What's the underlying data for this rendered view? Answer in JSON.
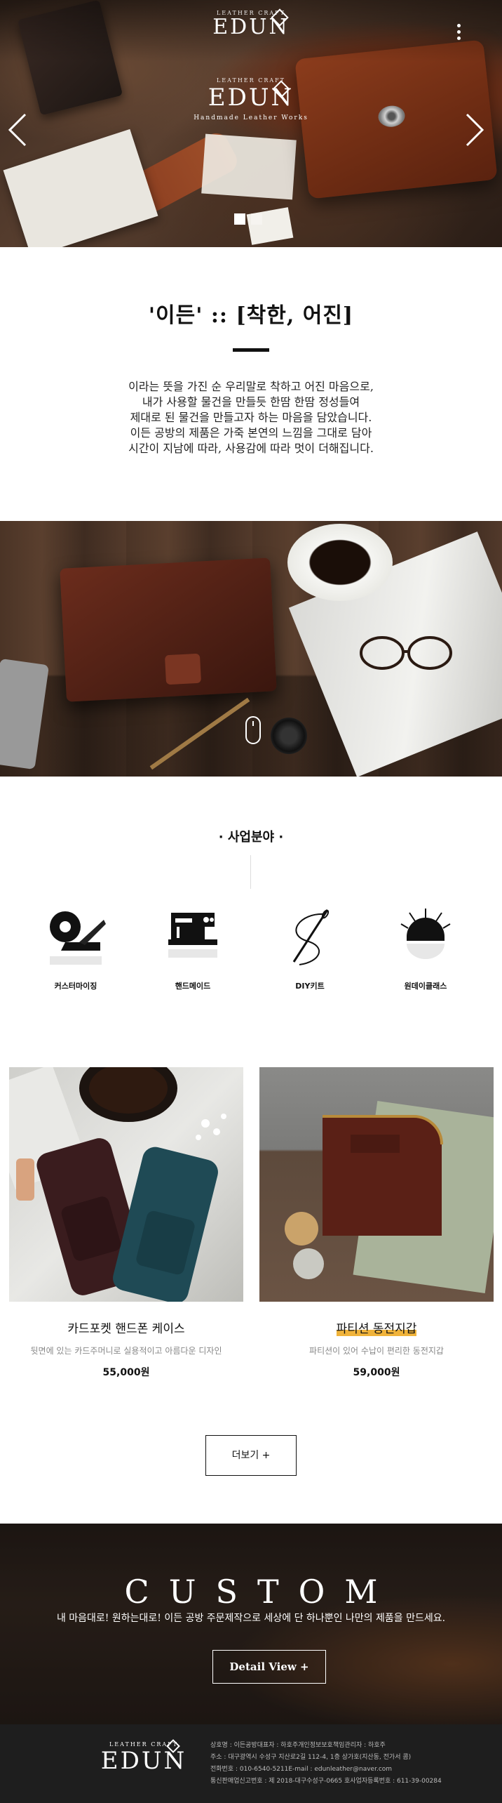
{
  "header": {
    "brand_small": "LEATHER CRAFT",
    "brand_name": "EDUN",
    "menu_icon": "more-vertical-icon"
  },
  "hero": {
    "brand_small": "LEATHER CRAFT",
    "brand_name": "EDUN",
    "tagline": "Handmade Leather Works",
    "slides_total": 2,
    "slide_active": 1
  },
  "intro": {
    "title": "'이든' :: [착한, 어진]",
    "lines": [
      "이라는 뜻을 가진 순 우리말로 착하고 어진 마음으로,",
      "내가 사용할 물건을 만들듯 한땀 한땀 정성들여",
      "제대로 된 물건을 만들고자 하는 마음을 담았습니다.",
      "이든 공방의 제품은 가죽 본연의 느낌을 그대로 담아",
      "시간이 지남에 따라, 사용감에 따라 멋이 더해집니다."
    ]
  },
  "business": {
    "title": "· 사업분야 ·",
    "items": [
      {
        "label": "커스터마이징",
        "icon": "measuring-tape-icon"
      },
      {
        "label": "핸드메이드",
        "icon": "sewing-machine-icon"
      },
      {
        "label": "DIY키트",
        "icon": "needle-thread-icon"
      },
      {
        "label": "원데이클래스",
        "icon": "pincushion-icon"
      }
    ]
  },
  "products": [
    {
      "name": "카드포켓 핸드폰 케이스",
      "desc": "뒷면에 있는 카드주머니로 실용적이고 아름다운 디자인",
      "price": "55,000원"
    },
    {
      "name": "파티션 동전지갑",
      "desc": "파티션이 있어 수납이 편리한 동전지갑",
      "price": "59,000원"
    }
  ],
  "more_button": "더보기 +",
  "custom": {
    "title": "CUSTOM",
    "subtitle": "내 마음대로! 원하는대로! 이든 공방 주문제작으로 세상에 단 하나뿐인 나만의 제품을 만드세요.",
    "button": "Detail View +"
  },
  "footer": {
    "brand_small": "LEATHER CRAFT",
    "brand_name": "EDUN",
    "info": [
      "상호명 : 이든공방대표자 : 하호주개인정보보호책임관리자 : 하호주",
      "주소 : 대구광역시 수성구 지산로2길 112-4, 1층 상가호(지산동, 전가서 콤)",
      "전화번호 : 010-6540-5211E-mail : edunleather@naver.com",
      "통신판매업신고번호 : 제 2018-대구수성구-0665 호사업자등록번호 : 611-39-00284"
    ]
  }
}
